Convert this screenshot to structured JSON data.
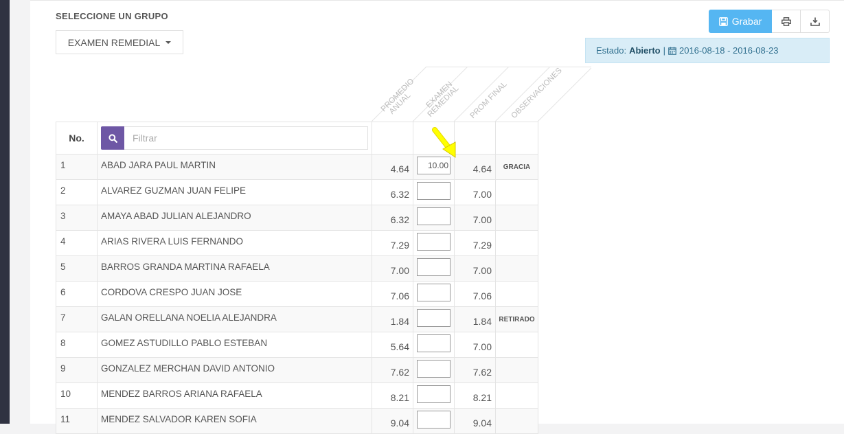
{
  "group": {
    "label": "SELECCIONE UN GRUPO",
    "selected": "EXAMEN REMEDIAL"
  },
  "toolbar": {
    "save_label": "Grabar",
    "save_icon": "floppy-icon",
    "print_icon": "print-icon",
    "download_icon": "download-icon"
  },
  "status": {
    "label": "Estado:",
    "value": "Abierto",
    "separator": "|",
    "dates": "2016-08-18 - 2016-08-23"
  },
  "columns": {
    "no": "No.",
    "promedio_anual": [
      "PROMEDIO",
      "ANUAL"
    ],
    "examen_remedial": [
      "EXAMEN",
      "REMEDIAL"
    ],
    "prom_final": [
      "PROM FINAL"
    ],
    "observaciones": [
      "OBSERVACIONES"
    ]
  },
  "filter": {
    "placeholder": "Filtrar"
  },
  "colors": {
    "save_button": "#55b6f2",
    "filter_button": "#6e57a5",
    "status_bg": "#d9edf7",
    "sidebar": "#2f3241",
    "arrow": "#ffff00"
  },
  "rows": [
    {
      "no": "1",
      "name": "ABAD JARA PAUL MARTIN",
      "anual": "4.64",
      "remedial": "10.00",
      "final": "4.64",
      "obs": "GRACIA"
    },
    {
      "no": "2",
      "name": "ALVAREZ GUZMAN JUAN FELIPE",
      "anual": "6.32",
      "remedial": "",
      "final": "7.00",
      "obs": ""
    },
    {
      "no": "3",
      "name": "AMAYA ABAD JULIAN ALEJANDRO",
      "anual": "6.32",
      "remedial": "",
      "final": "7.00",
      "obs": ""
    },
    {
      "no": "4",
      "name": "ARIAS RIVERA LUIS FERNANDO",
      "anual": "7.29",
      "remedial": "",
      "final": "7.29",
      "obs": ""
    },
    {
      "no": "5",
      "name": "BARROS GRANDA MARTINA RAFAELA",
      "anual": "7.00",
      "remedial": "",
      "final": "7.00",
      "obs": ""
    },
    {
      "no": "6",
      "name": "CORDOVA CRESPO JUAN JOSE",
      "anual": "7.06",
      "remedial": "",
      "final": "7.06",
      "obs": ""
    },
    {
      "no": "7",
      "name": "GALAN ORELLANA NOELIA ALEJANDRA",
      "anual": "1.84",
      "remedial": "",
      "final": "1.84",
      "obs": "RETIRADO"
    },
    {
      "no": "8",
      "name": "GOMEZ ASTUDILLO PABLO ESTEBAN",
      "anual": "5.64",
      "remedial": "",
      "final": "7.00",
      "obs": ""
    },
    {
      "no": "9",
      "name": "GONZALEZ MERCHAN DAVID ANTONIO",
      "anual": "7.62",
      "remedial": "",
      "final": "7.62",
      "obs": ""
    },
    {
      "no": "10",
      "name": "MENDEZ BARROS ARIANA RAFAELA",
      "anual": "8.21",
      "remedial": "",
      "final": "8.21",
      "obs": ""
    },
    {
      "no": "11",
      "name": "MENDEZ SALVADOR KAREN SOFIA",
      "anual": "9.04",
      "remedial": "",
      "final": "9.04",
      "obs": ""
    }
  ]
}
